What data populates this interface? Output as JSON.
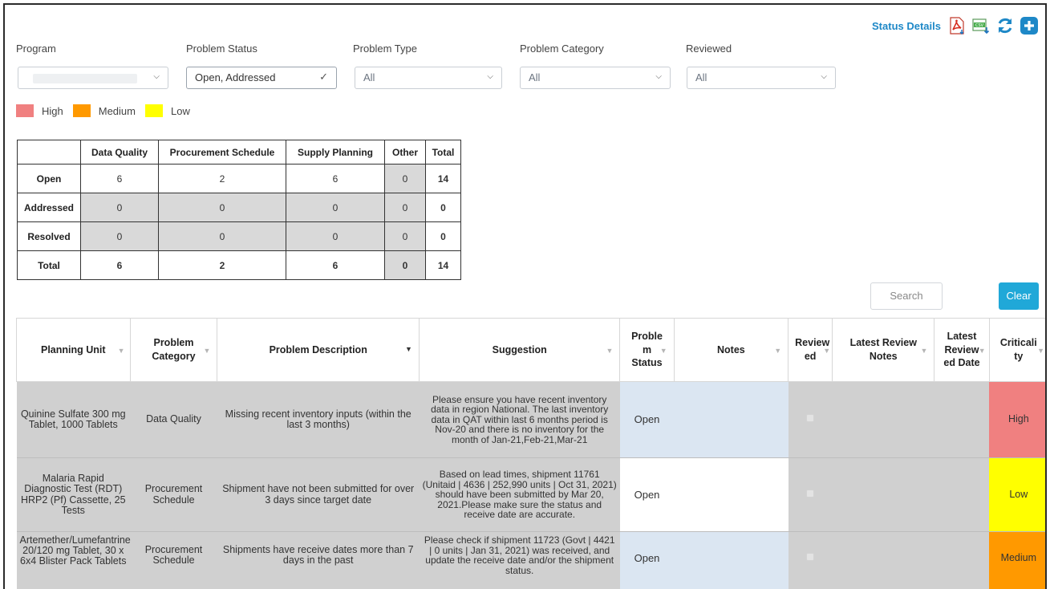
{
  "toolbar": {
    "status_details": "Status Details",
    "icons": [
      "pdf-export-icon",
      "csv-export-icon",
      "refresh-icon",
      "add-icon"
    ]
  },
  "filters": {
    "program": {
      "label": "Program",
      "value": ""
    },
    "problem_status": {
      "label": "Problem Status",
      "value": "Open, Addressed"
    },
    "problem_type": {
      "label": "Problem Type",
      "value": "All"
    },
    "problem_category": {
      "label": "Problem Category",
      "value": "All"
    },
    "reviewed": {
      "label": "Reviewed",
      "value": "All"
    }
  },
  "legend": [
    {
      "label": "High",
      "color": "#f08080"
    },
    {
      "label": "Medium",
      "color": "#ff9900"
    },
    {
      "label": "Low",
      "color": "#ffff00"
    }
  ],
  "summary": {
    "headers": [
      "",
      "Data Quality",
      "Procurement Schedule",
      "Supply Planning",
      "Other",
      "Total"
    ],
    "rows": [
      {
        "label": "Open",
        "values": [
          "6",
          "2",
          "6",
          "0",
          "14"
        ]
      },
      {
        "label": "Addressed",
        "values": [
          "0",
          "0",
          "0",
          "0",
          "0"
        ]
      },
      {
        "label": "Resolved",
        "values": [
          "0",
          "0",
          "0",
          "0",
          "0"
        ]
      },
      {
        "label": "Total",
        "values": [
          "6",
          "2",
          "6",
          "0",
          "14"
        ]
      }
    ]
  },
  "search": {
    "placeholder": "Search",
    "clear_label": "Clear"
  },
  "table": {
    "headers": {
      "planning_unit": "Planning Unit",
      "problem_category": "Problem Category",
      "problem_description": "Problem Description",
      "suggestion": "Suggestion",
      "problem_status": "Proble m Status",
      "notes": "Notes",
      "reviewed": "Review ed",
      "latest_review_notes": "Latest Review Notes",
      "latest_reviewed_date": "Latest Review ed Date",
      "criticality": "Criticali ty"
    },
    "rows": [
      {
        "planning_unit": "Quinine Sulfate 300 mg Tablet, 1000 Tablets",
        "problem_category": "Data Quality",
        "problem_description": "Missing recent inventory inputs (within the last 3 months)",
        "suggestion": "Please ensure you have recent inventory data in region National. The last inventory data in QAT within last 6 months period is  Nov-20 and there is no inventory for the month of Jan-21,Feb-21,Mar-21",
        "problem_status": "Open",
        "notes": "",
        "latest_review_notes": "",
        "latest_reviewed_date": "",
        "criticality": "High",
        "criticality_color": "#f08080"
      },
      {
        "planning_unit": "Malaria Rapid Diagnostic Test (RDT) HRP2 (Pf) Cassette, 25 Tests",
        "problem_category": "Procurement Schedule",
        "problem_description": "Shipment have not been submitted for over 3 days since target date",
        "suggestion": "Based on lead times, shipment 11761 (Unitaid | 4636 | 252,990 units | Oct 31, 2021) should have been submitted by Mar 20, 2021.Please make sure the status and receive date are accurate.",
        "problem_status": "Open",
        "notes": "",
        "latest_review_notes": "",
        "latest_reviewed_date": "",
        "criticality": "Low",
        "criticality_color": "#ffff00"
      },
      {
        "planning_unit": "Artemether/Lumefantrine 20/120 mg Tablet, 30 x 6x4 Blister Pack Tablets",
        "problem_category": "Procurement Schedule",
        "problem_description": "Shipments have receive dates more than 7 days in the past",
        "suggestion": "Please check if shipment 11723 (Govt | 4421 | 0 units | Jan 31, 2021) was received, and update the receive date and/or the shipment status.",
        "problem_status": "Open",
        "notes": "",
        "latest_review_notes": "",
        "latest_reviewed_date": "",
        "criticality": "Medium",
        "criticality_color": "#ff9900"
      }
    ]
  }
}
